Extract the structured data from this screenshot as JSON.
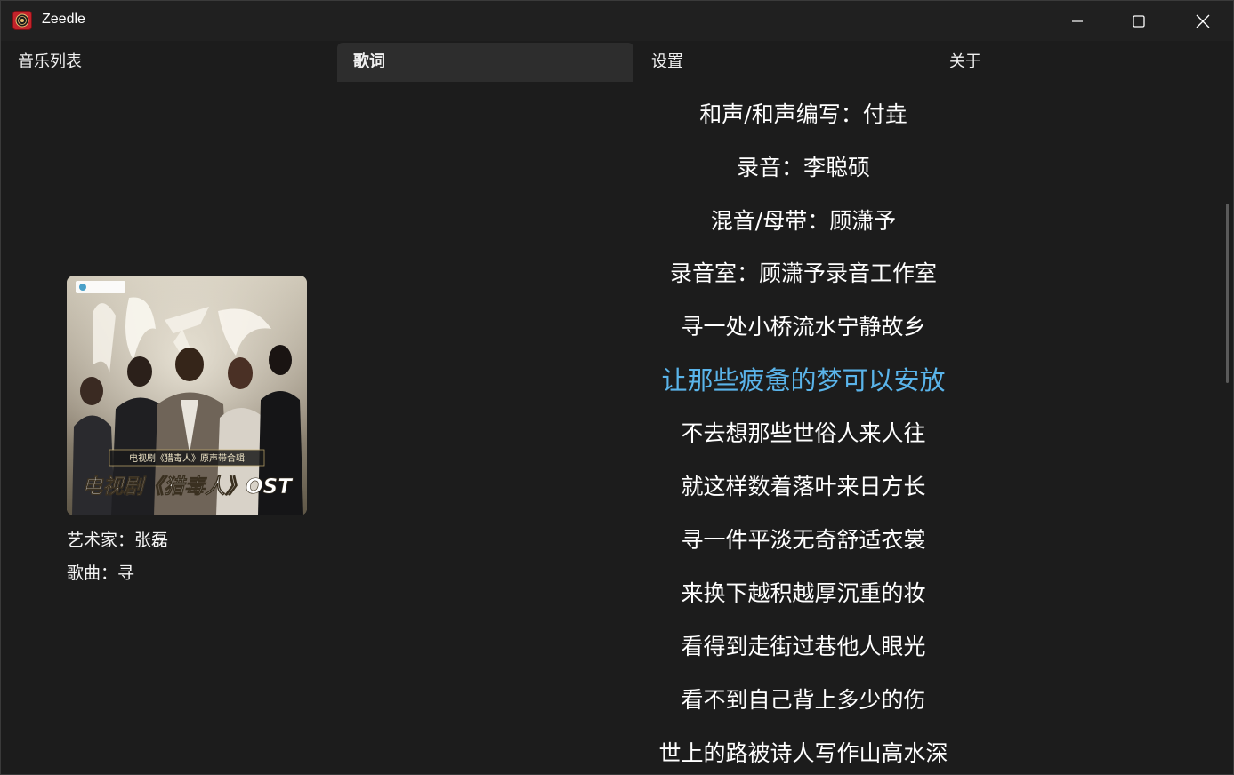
{
  "app": {
    "title": "Zeedle",
    "icon": "record-icon",
    "window_controls": [
      "minimize-icon",
      "maximize-icon",
      "close-icon"
    ]
  },
  "tabs": [
    {
      "label": "音乐列表",
      "active": false
    },
    {
      "label": "歌词",
      "active": true
    },
    {
      "label": "设置",
      "active": false
    },
    {
      "label": "关于",
      "active": false
    }
  ],
  "now_playing": {
    "cover": {
      "banner_text": "电视剧《猎毒人》原声带合辑",
      "title_text": "电视剧《猎毒人》OST",
      "calligraphy": "猎毒人"
    },
    "artist_line": "艺术家：张磊",
    "song_line": "歌曲：寻"
  },
  "lyrics": {
    "lines": [
      "和声/和声编写：付垚",
      "录音：李聪硕",
      "混音/母带：顾潇予",
      "录音室：顾潇予录音工作室",
      "寻一处小桥流水宁静故乡",
      "让那些疲惫的梦可以安放",
      "不去想那些世俗人来人往",
      "就这样数着落叶来日方长",
      "寻一件平淡无奇舒适衣裳",
      "来换下越积越厚沉重的妆",
      "看得到走街过巷他人眼光",
      "看不到自己背上多少的伤",
      "世上的路被诗人写作山高水深"
    ],
    "active_index": 5
  },
  "colors": {
    "background": "#1c1c1c",
    "titlebar": "#202020",
    "active_tab": "#2d2d2d",
    "active_lyric": "#5ab4ea",
    "icon_red": "#c2232b"
  }
}
